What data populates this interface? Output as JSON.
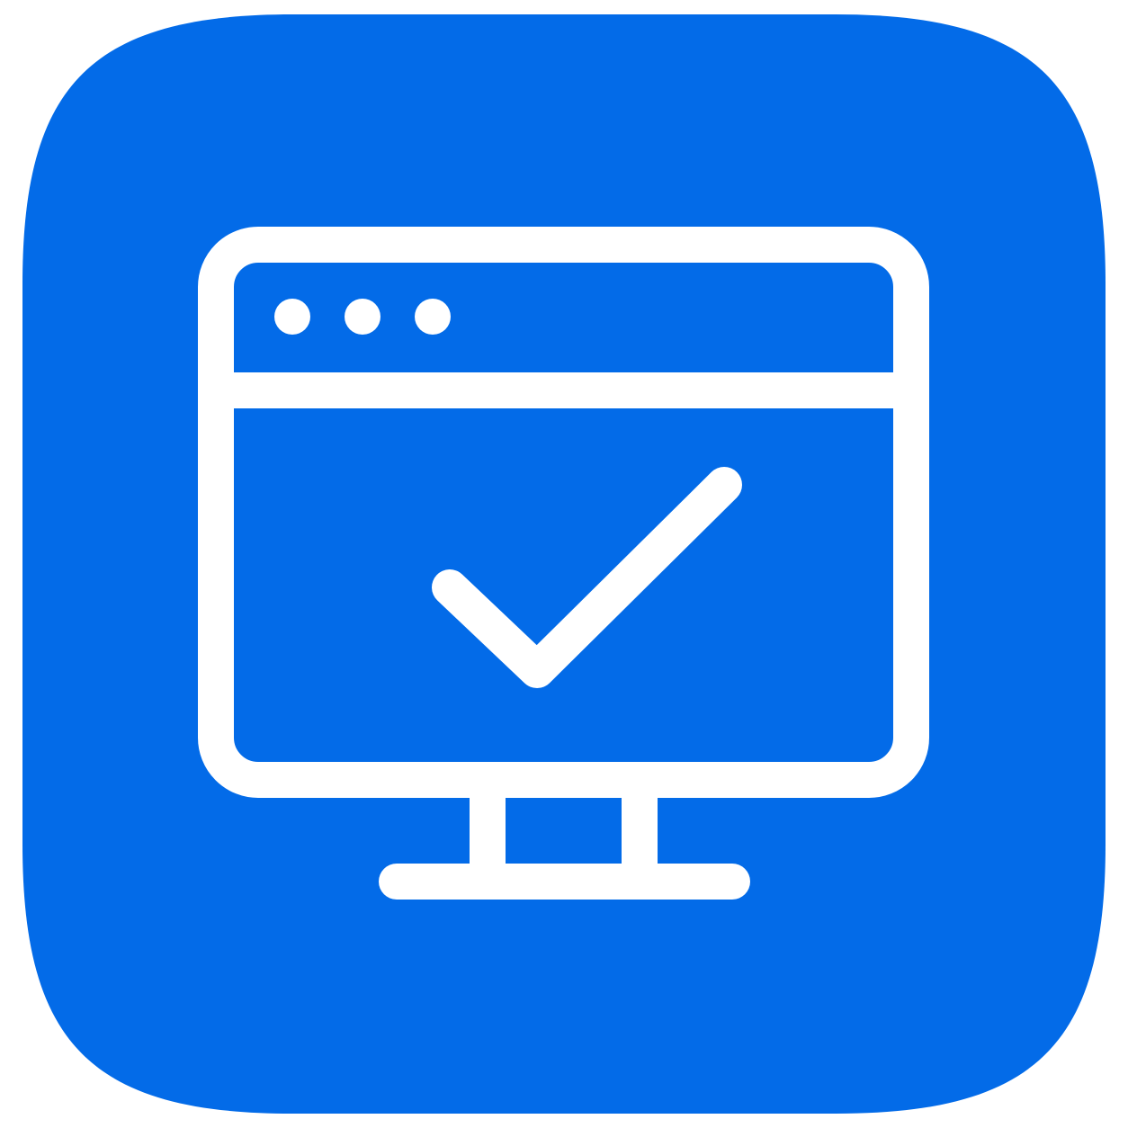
{
  "icon": {
    "name": "computer-check-app-icon",
    "background_color": "#036BE8",
    "foreground_color": "#FFFFFF",
    "depicts": [
      "monitor-icon",
      "browser-window-icon",
      "window-dots-icon",
      "checkmark-icon",
      "monitor-stand-icon"
    ]
  }
}
